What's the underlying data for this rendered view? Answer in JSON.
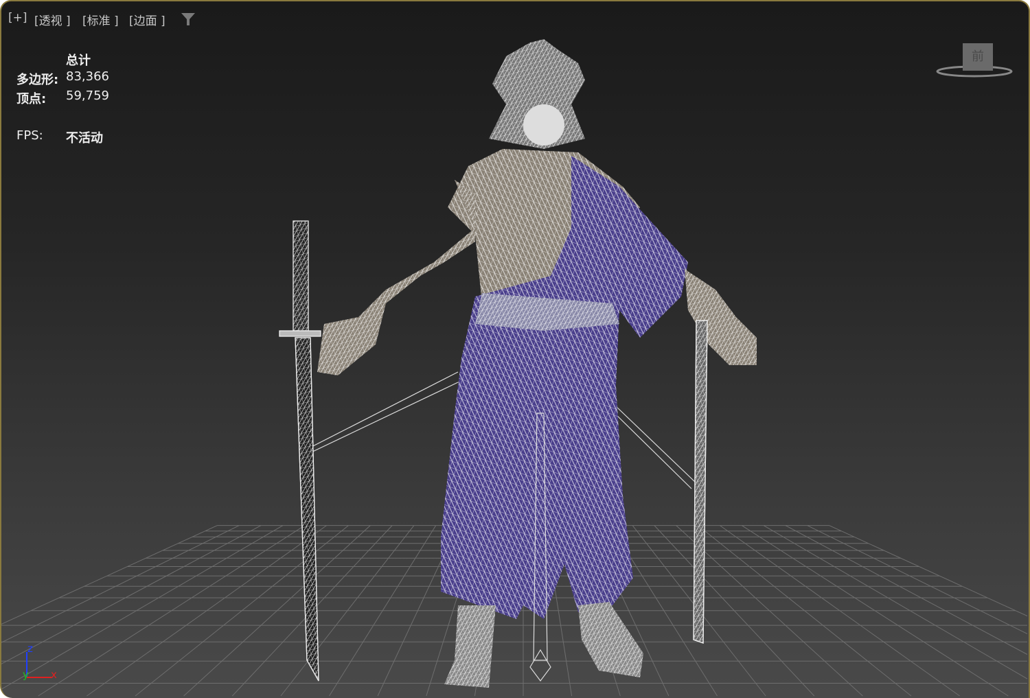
{
  "viewport": {
    "labels": {
      "plus": "[+]",
      "view": "[透视 ]",
      "shading": "[标准 ]",
      "style": "[边面 ]"
    },
    "stats": {
      "header": "总计",
      "polygons_label": "多边形:",
      "polygons_value": "83,366",
      "vertices_label": "顶点:",
      "vertices_value": "59,759",
      "fps_label": "FPS:",
      "fps_value": "不活动"
    },
    "viewcube_face": "前",
    "axis": {
      "z": "z",
      "y": "y",
      "x": "x"
    },
    "colors": {
      "border": "#8a7a3e",
      "robe": "#4a3f8c",
      "skin": "#8a8276",
      "wire": "#ffffff",
      "axis_x": "#e02020",
      "axis_y": "#20c020",
      "axis_z": "#2040ff"
    }
  }
}
